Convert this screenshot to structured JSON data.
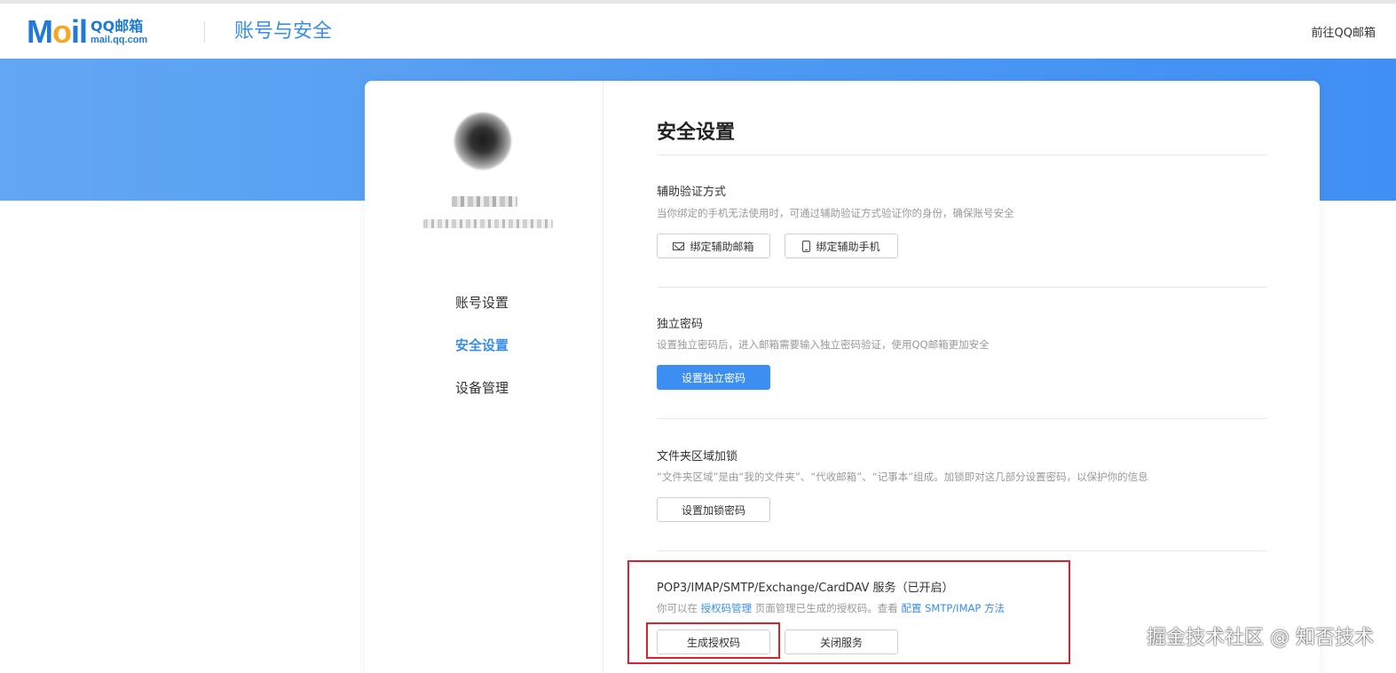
{
  "header": {
    "logo_mail": "Mail",
    "logo_cn": "QQ邮箱",
    "logo_domain": "mail.qq.com",
    "page_title": "账号与安全",
    "goto_link": "前往QQ邮箱"
  },
  "sidebar": {
    "items": [
      {
        "label": "账号设置",
        "active": false
      },
      {
        "label": "安全设置",
        "active": true
      },
      {
        "label": "设备管理",
        "active": false
      }
    ]
  },
  "main": {
    "title": "安全设置",
    "sections": [
      {
        "title": "辅助验证方式",
        "desc": "当你绑定的手机无法使用时，可通过辅助验证方式验证你的身份，确保账号安全",
        "buttons": [
          {
            "label": "绑定辅助邮箱",
            "icon": "mail-icon"
          },
          {
            "label": "绑定辅助手机",
            "icon": "phone-icon"
          }
        ]
      },
      {
        "title": "独立密码",
        "desc": "设置独立密码后，进入邮箱需要输入独立密码验证，使用QQ邮箱更加安全",
        "buttons": [
          {
            "label": "设置独立密码",
            "primary": true
          }
        ]
      },
      {
        "title": "文件夹区域加锁",
        "desc": "“文件夹区域”是由“我的文件夹”、“代收邮箱”、“记事本”组成。加锁即对这几部分设置密码，以保护你的信息",
        "buttons": [
          {
            "label": "设置加锁密码"
          }
        ]
      },
      {
        "title": "POP3/IMAP/SMTP/Exchange/CardDAV 服务（已开启）",
        "desc_parts": {
          "p1": "你可以在 ",
          "link1": "授权码管理",
          "p2": " 页面管理已生成的授权码。查看 ",
          "link2": "配置 SMTP/IMAP 方法"
        },
        "buttons": [
          {
            "label": "生成授权码"
          },
          {
            "label": "关闭服务"
          }
        ]
      }
    ]
  },
  "watermark": "掘金技术社区 @ 知否技术",
  "colors": {
    "accent": "#3a8ee6",
    "primary_button": "#3d8ef2",
    "highlight_border": "#d9232f",
    "banner": "#4b98f2"
  }
}
